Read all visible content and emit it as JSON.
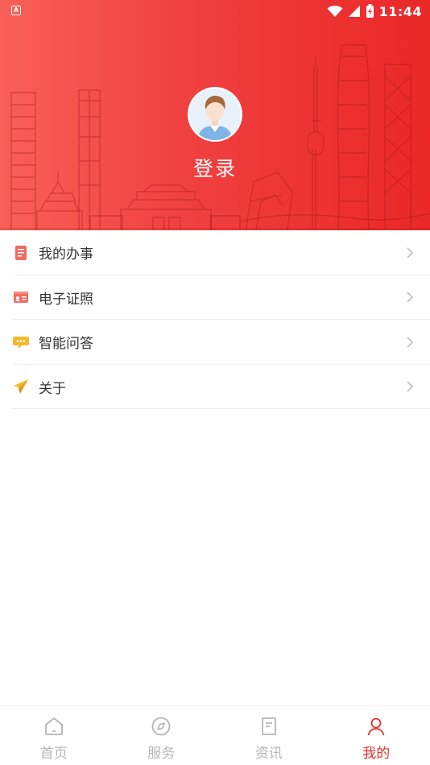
{
  "status_bar": {
    "notification_glyph": "A",
    "time": "11:44",
    "icons": [
      "wifi-icon",
      "signal-icon",
      "battery-charging-icon"
    ]
  },
  "profile": {
    "avatar_icon": "user-avatar",
    "login_label": "登录"
  },
  "menu": {
    "items": [
      {
        "label": "我的办事",
        "icon": "document-icon",
        "icon_color": "#f06a5f"
      },
      {
        "label": "电子证照",
        "icon": "id-card-icon",
        "icon_color": "#f06a5f"
      },
      {
        "label": "智能问答",
        "icon": "chat-bubble-icon",
        "icon_color": "#f5b92f"
      },
      {
        "label": "关于",
        "icon": "paper-plane-icon",
        "icon_color": "#f5b92f"
      }
    ]
  },
  "tabbar": {
    "tabs": [
      {
        "label": "首页",
        "icon": "home-icon",
        "active": false
      },
      {
        "label": "服务",
        "icon": "compass-icon",
        "active": false
      },
      {
        "label": "资讯",
        "icon": "news-icon",
        "active": false
      },
      {
        "label": "我的",
        "icon": "person-icon",
        "active": true
      }
    ]
  },
  "colors": {
    "header_start": "#f86058",
    "header_end": "#ea2828",
    "active_tab": "#e8302f",
    "inactive_tab": "#b5b5b5"
  }
}
